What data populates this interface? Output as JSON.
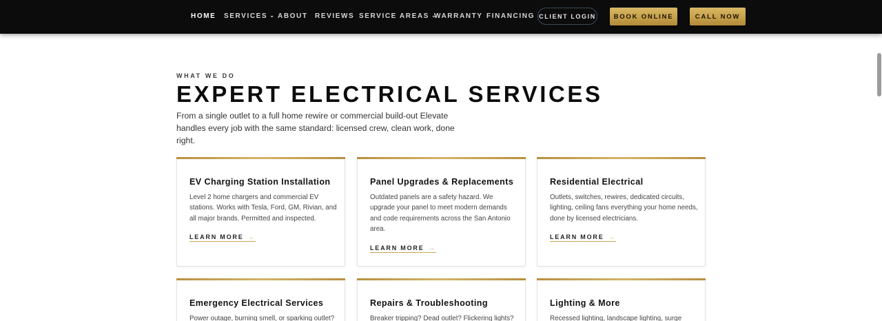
{
  "nav": {
    "links": [
      "HOME",
      "SERVICES",
      "ABOUT",
      "REVIEWS",
      "SERVICE AREAS",
      "WARRANTY",
      "FINANCING"
    ],
    "client_login": "CLIENT LOGIN",
    "book_online": "BOOK ONLINE",
    "call_now": "CALL NOW"
  },
  "section": {
    "eyebrow": "WHAT WE DO",
    "title": "EXPERT ELECTRICAL SERVICES",
    "intro": "From a single outlet to a full home rewire or commercial build-out Elevate handles every job with the same standard: licensed crew, clean work, done right."
  },
  "cards": [
    {
      "title": "EV Charging Station Installation",
      "text": "Level 2 home chargers and commercial EV stations. Works with Tesla, Ford, GM, Rivian, and all major brands. Permitted and inspected.",
      "link": "LEARN MORE"
    },
    {
      "title": "Panel Upgrades & Replacements",
      "text": "Outdated panels are a safety hazard. We upgrade your panel to meet modern demands and code requirements across the San Antonio area.",
      "link": "LEARN MORE"
    },
    {
      "title": "Residential Electrical",
      "text": "Outlets, switches, rewires, dedicated circuits, lighting, ceiling fans everything your home needs, done by licensed electricians.",
      "link": "LEARN MORE"
    },
    {
      "title": "Emergency Electrical Services",
      "text": "Power outage, burning smell, or sparking outlet?"
    },
    {
      "title": "Repairs & Troubleshooting",
      "text": "Breaker tripping? Dead outlet? Flickering lights?"
    },
    {
      "title": "Lighting & More",
      "text": "Recessed lighting, landscape lighting, surge"
    }
  ],
  "icons": {
    "dropdown": "chevron-down-icon",
    "link_arrow": "arrow-right-icon"
  },
  "colors": {
    "nav_bg": "#0c0c0c",
    "accent_gold": "#c9a451",
    "title": "#0c0c0c"
  }
}
